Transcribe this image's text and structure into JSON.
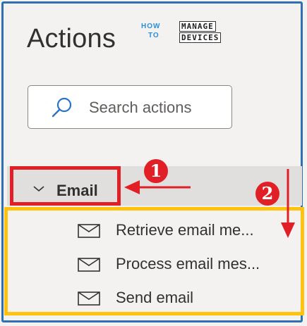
{
  "panel": {
    "title": "Actions",
    "logo": {
      "line1": "HOW",
      "line2": "TO",
      "word1": "MANAGE",
      "word2": "DEVICES"
    }
  },
  "search": {
    "placeholder": "Search actions",
    "icon": "search-icon"
  },
  "group": {
    "label": "Email",
    "expanded": true,
    "chevron": "chevron-down-icon",
    "items": [
      {
        "label": "Retrieve email me...",
        "icon": "mail-icon"
      },
      {
        "label": "Process email mes...",
        "icon": "mail-icon"
      },
      {
        "label": "Send email",
        "icon": "mail-icon"
      }
    ]
  },
  "annotations": {
    "badge1": "1",
    "badge2": "2",
    "highlight_color_1": "#e01f26",
    "highlight_color_2": "#ffc20e"
  }
}
